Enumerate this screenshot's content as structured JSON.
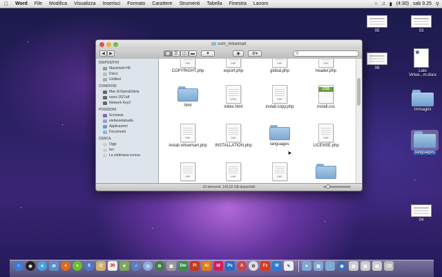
{
  "menubar": {
    "apple": "",
    "items": [
      "Word",
      "File",
      "Modifica",
      "Visualizza",
      "Inserisci",
      "Formato",
      "Carattere",
      "Strumenti",
      "Tabella",
      "Finestra",
      "Lavoro"
    ],
    "battery": "(4:30)",
    "clock": "sab 9.25"
  },
  "window": {
    "title": "com_virtuemart",
    "search_placeholder": "",
    "status": "33 elementi, 143,32 GB disponibili"
  },
  "sidebar": {
    "sections": [
      {
        "heading": "DISPOSITIVI",
        "items": [
          "Macintosh HD",
          "Disco",
          "Untitled"
        ]
      },
      {
        "heading": "CONDIVISI",
        "items": [
          "Mac di Nuno&Silvia",
          "nuno-1527a8",
          "Network Key2"
        ]
      },
      {
        "heading": "POSIZIONI",
        "items": [
          "Scrivania",
          "stefanoetalvalla",
          "Applicazioni",
          "Documenti"
        ]
      },
      {
        "heading": "CERCA",
        "items": [
          "Oggi",
          "Ieri",
          "La settimana scorsa"
        ]
      }
    ]
  },
  "files": [
    {
      "name": "COPYRIGHT.php",
      "kind": "doc",
      "tag": "PHP"
    },
    {
      "name": "export.php",
      "kind": "doc",
      "tag": "PHP"
    },
    {
      "name": "global.php",
      "kind": "doc",
      "tag": "PHP"
    },
    {
      "name": "header.php",
      "kind": "doc",
      "tag": "PHP"
    },
    {
      "name": "html",
      "kind": "folder",
      "tag": ""
    },
    {
      "name": "index.html",
      "kind": "doc",
      "tag": "HTML"
    },
    {
      "name": "install.copy.php",
      "kind": "doc",
      "tag": "PHP"
    },
    {
      "name": "install.css",
      "kind": "css",
      "tag": "CSS"
    },
    {
      "name": "install.virtuemart.php",
      "kind": "doc",
      "tag": "PHP"
    },
    {
      "name": "INSTALLATION.php",
      "kind": "doc",
      "tag": "PHP"
    },
    {
      "name": "languages",
      "kind": "folder",
      "tag": ""
    },
    {
      "name": "LICENSE.php",
      "kind": "doc",
      "tag": "PHP"
    },
    {
      "name": "",
      "kind": "doc",
      "tag": "PHP"
    },
    {
      "name": "",
      "kind": "doc",
      "tag": "PHP"
    },
    {
      "name": "",
      "kind": "doc",
      "tag": "PHP"
    },
    {
      "name": "",
      "kind": "folder",
      "tag": ""
    }
  ],
  "desktop": [
    {
      "label": "05",
      "kind": "thumb"
    },
    {
      "label": "03",
      "kind": "thumb"
    },
    {
      "label": "06",
      "kind": "thumb"
    },
    {
      "label": "Lato Virtue...m.docx",
      "kind": "wdoc"
    },
    {
      "label": "Immagini",
      "kind": "folder"
    },
    {
      "label": "languages",
      "kind": "folder-selected"
    },
    {
      "label": "04",
      "kind": "thumb"
    }
  ],
  "colors": {
    "accent": "#3d6fcf",
    "folder": "#7ea9d2"
  }
}
